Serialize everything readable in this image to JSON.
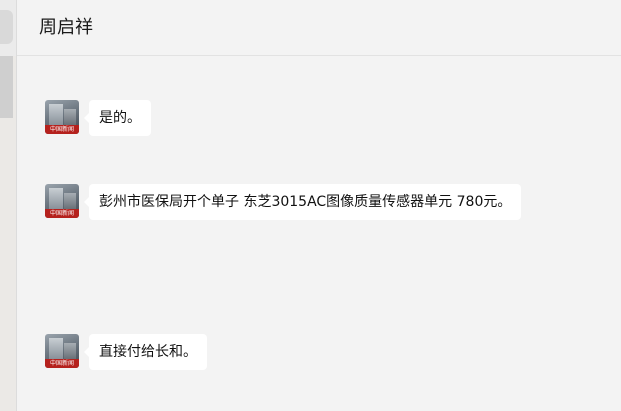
{
  "chat": {
    "title": "周启祥"
  },
  "avatar": {
    "badge_text": "中国新闻"
  },
  "messages": [
    {
      "text": "是的。"
    },
    {
      "text": "彭州市医保局开个单子 东芝3015AC图像质量传感器单元 780元。"
    },
    {
      "text": "直接付给长和。"
    }
  ],
  "colors": {
    "background": "#f3f3f3",
    "bubble": "#ffffff",
    "avatar_band": "#b5211d"
  }
}
